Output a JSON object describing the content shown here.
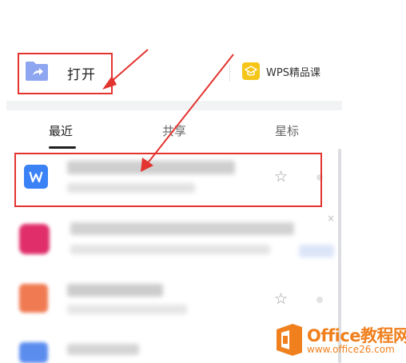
{
  "toolbar": {
    "open_label": "打开",
    "course_label": "WPS精品课"
  },
  "tabs": [
    {
      "label": "最近",
      "active": true
    },
    {
      "label": "共享",
      "active": false
    },
    {
      "label": "星标",
      "active": false
    }
  ],
  "recent_files": [
    {
      "type": "wps-writer",
      "icon_glyph": "W",
      "icon_color": "#3b82f6",
      "highlighted": true
    },
    {
      "type": "blurred",
      "icon_color": "#e02e6b",
      "highlighted": false
    },
    {
      "type": "blurred",
      "icon_color": "#f07a52",
      "highlighted": false
    },
    {
      "type": "blurred",
      "icon_color": "#5b8def",
      "highlighted": false
    }
  ],
  "icons": {
    "open": "folder-share-icon",
    "course": "graduation-cap-icon",
    "star": "star-outline-icon",
    "close": "close-icon"
  },
  "glyphs": {
    "star": "☆",
    "close": "×"
  },
  "colors": {
    "annotation": "#e3342f",
    "folder": "#8ea5f0",
    "course_icon": "#f5c518",
    "watermark": "#f0801e"
  },
  "watermark": {
    "text": "Office教程网",
    "url": "www.office26.com"
  }
}
